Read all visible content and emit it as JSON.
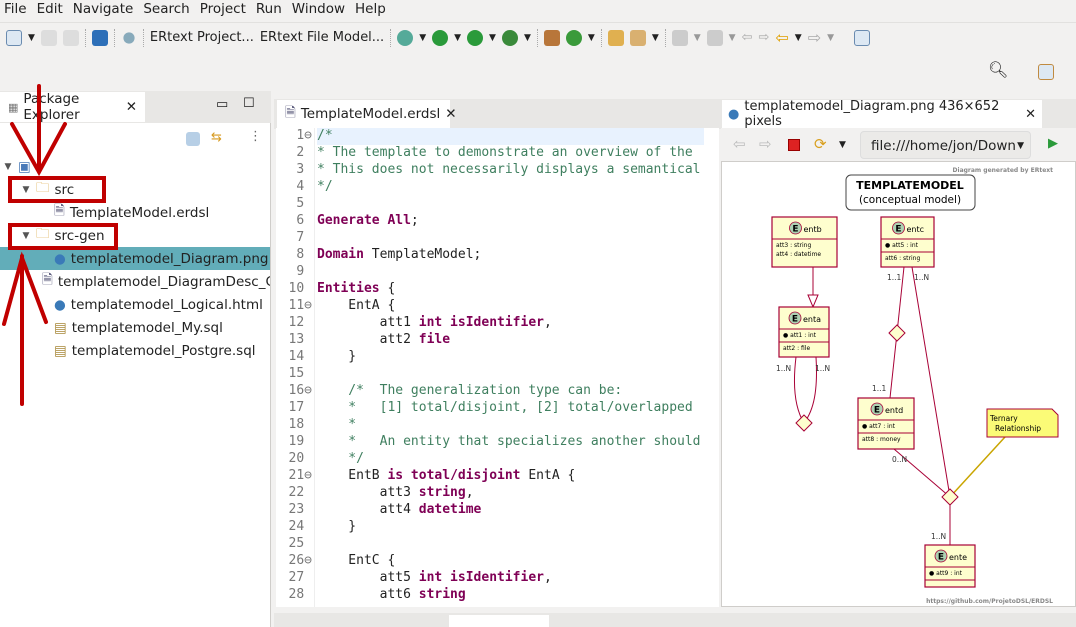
{
  "menu": [
    "File",
    "Edit",
    "Navigate",
    "Search",
    "Project",
    "Run",
    "Window",
    "Help"
  ],
  "toolbar": {
    "ertext_project": "ERtext Project...",
    "ertext_file_model": "ERtext File Model..."
  },
  "explorer": {
    "tab_label": "Package Explorer",
    "items": [
      {
        "label": "",
        "type": "project",
        "expanded": true
      },
      {
        "label": "src",
        "type": "folder",
        "expanded": true
      },
      {
        "label": "TemplateModel.erdsl",
        "type": "file"
      },
      {
        "label": "src-gen",
        "type": "folder",
        "expanded": true
      },
      {
        "label": "templatemodel_Diagram.png",
        "type": "web",
        "selected": true
      },
      {
        "label": "templatemodel_DiagramDesc_Gen",
        "type": "file"
      },
      {
        "label": "templatemodel_Logical.html",
        "type": "web"
      },
      {
        "label": "templatemodel_My.sql",
        "type": "sql"
      },
      {
        "label": "templatemodel_Postgre.sql",
        "type": "sql"
      }
    ]
  },
  "editor": {
    "tab_label": "TemplateModel.erdsl",
    "lines": [
      [
        [
          "c",
          "/*"
        ]
      ],
      [
        [
          "c",
          "* The template to demonstrate an overview of the"
        ]
      ],
      [
        [
          "c",
          "* This does not necessarily displays a semantical"
        ]
      ],
      [
        [
          "c",
          "*/"
        ]
      ],
      [],
      [
        [
          "k",
          "Generate All"
        ],
        [
          "n",
          ";"
        ]
      ],
      [],
      [
        [
          "k",
          "Domain"
        ],
        [
          "n",
          " TemplateModel;"
        ]
      ],
      [],
      [
        [
          "k",
          "Entities"
        ],
        [
          "n",
          " {"
        ]
      ],
      [
        [
          "n",
          "    EntA {"
        ]
      ],
      [
        [
          "n",
          "        att1 "
        ],
        [
          "k",
          "int isIdentifier"
        ],
        [
          "n",
          ","
        ]
      ],
      [
        [
          "n",
          "        att2 "
        ],
        [
          "k",
          "file"
        ]
      ],
      [
        [
          "n",
          "    }"
        ]
      ],
      [],
      [
        [
          "c",
          "    /*  The generalization type can be:"
        ]
      ],
      [
        [
          "c",
          "    *   [1] total/disjoint, [2] total/overlapped"
        ]
      ],
      [
        [
          "c",
          "    *"
        ]
      ],
      [
        [
          "c",
          "    *   An entity that specializes another should"
        ]
      ],
      [
        [
          "c",
          "    */"
        ]
      ],
      [
        [
          "n",
          "    EntB "
        ],
        [
          "k",
          "is total/disjoint"
        ],
        [
          "n",
          " EntA {"
        ]
      ],
      [
        [
          "n",
          "        att3 "
        ],
        [
          "k",
          "string"
        ],
        [
          "n",
          ","
        ]
      ],
      [
        [
          "n",
          "        att4 "
        ],
        [
          "k",
          "datetime"
        ]
      ],
      [
        [
          "n",
          "    }"
        ]
      ],
      [],
      [
        [
          "n",
          "    EntC {"
        ]
      ],
      [
        [
          "n",
          "        att5 "
        ],
        [
          "k",
          "int isIdentifier"
        ],
        [
          "n",
          ","
        ]
      ],
      [
        [
          "n",
          "        att6 "
        ],
        [
          "k",
          "string"
        ]
      ]
    ],
    "fold_lines": [
      1,
      11,
      16,
      21,
      26
    ]
  },
  "browser": {
    "tab_label": "templatemodel_Diagram.png 436×652 pixels",
    "url": "file:///home/jon/Down",
    "diagram": {
      "generated_by": "Diagram generated by ERtext",
      "title": "TEMPLATEMODEL",
      "subtitle": "(conceptual model)",
      "footer": "https://github.com/ProjetoDSL/ERDSL",
      "note": [
        "Ternary",
        "Relationship"
      ],
      "entities": {
        "entb": {
          "name": "entb",
          "id_attrs": [],
          "attrs": [
            "att3 : string",
            "att4 : datetime"
          ]
        },
        "entc": {
          "name": "entc",
          "id_attrs": [
            "att5 : int"
          ],
          "attrs": [
            "att6 : string"
          ]
        },
        "enta": {
          "name": "enta",
          "id_attrs": [
            "att1 : int"
          ],
          "attrs": [
            "att2 : file"
          ]
        },
        "entd": {
          "name": "entd",
          "id_attrs": [
            "att7 : int"
          ],
          "attrs": [
            "att8 : money"
          ]
        },
        "ente": {
          "name": "ente",
          "id_attrs": [
            "att9 : int"
          ],
          "attrs": []
        }
      },
      "cardinalities": {
        "c_entc_a": "1..1",
        "c_entc_b": "1..N",
        "c_enta_a": "1..N",
        "c_enta_b": "1..N",
        "c_entd_top": "1..1",
        "c_entd_bot": "0..N",
        "c_ente": "1..N"
      }
    }
  },
  "colors": {
    "selection": "#62adb9",
    "keyword": "#7f0055",
    "comment": "#3f7f5f",
    "annotation": "#c00000",
    "entity_fill": "#fefece",
    "entity_border": "#a80036"
  }
}
